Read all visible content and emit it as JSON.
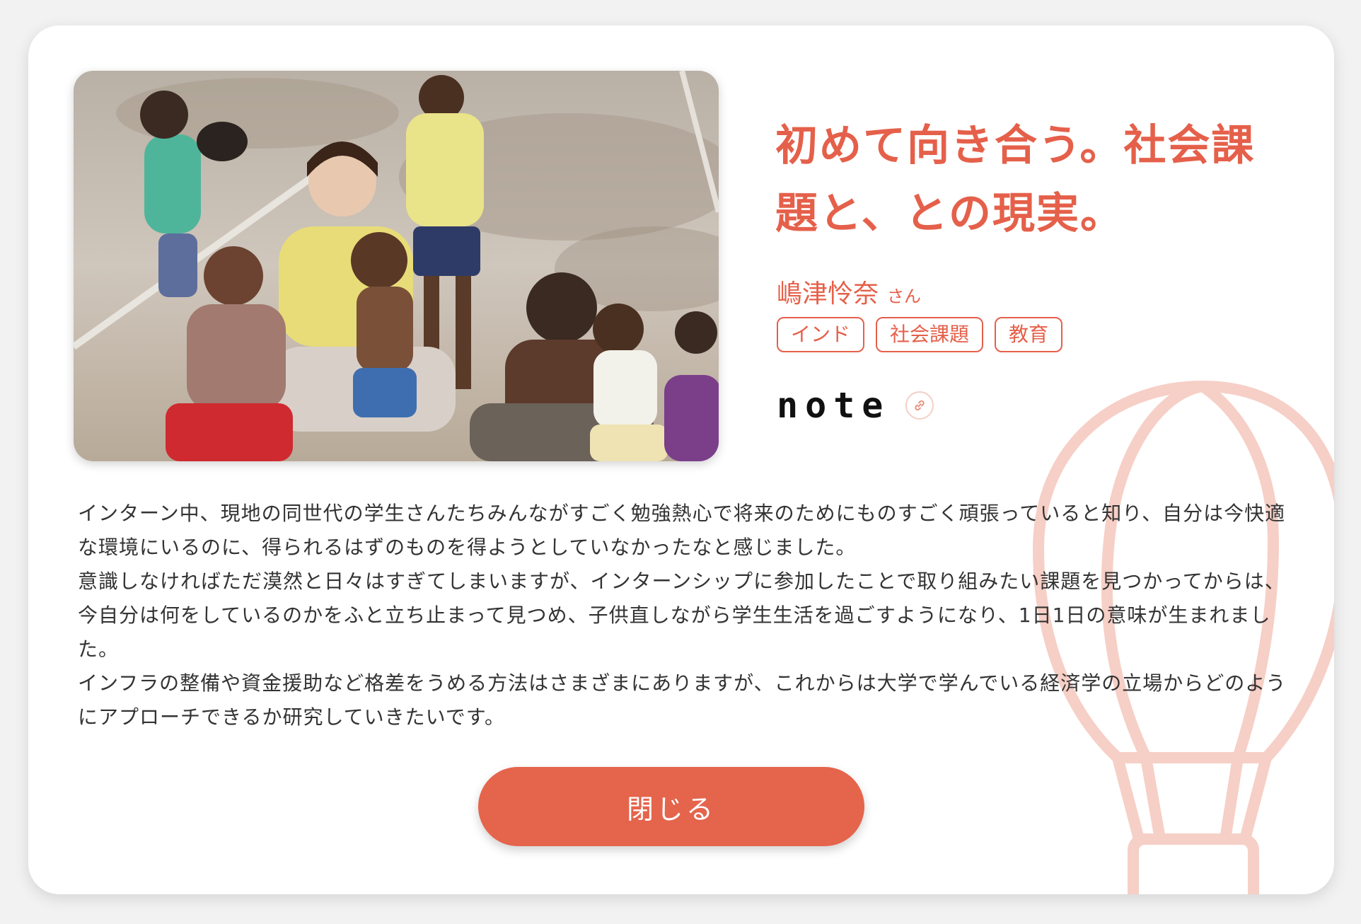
{
  "article": {
    "title": "初めて向き合う。社会課題と、との現実。",
    "author_name": "嶋津怜奈",
    "author_suffix": "さん",
    "tags": [
      "インド",
      "社会課題",
      "教育"
    ],
    "note_logo": "note",
    "body_paragraphs": [
      "インターン中、現地の同世代の学生さんたちみんながすごく勉強熱心で将来のためにものすごく頑張っていると知り、自分は今快適な環境にいるのに、得られるはずのものを得ようとしていなかったなと感じました。",
      "意識しなければただ漠然と日々はすぎてしまいますが、インターンシップに参加したことで取り組みたい課題を見つかってからは、今自分は何をしているのかをふと立ち止まって見つめ、子供直しながら学生生活を過ごすようになり、1日1日の意味が生まれました。",
      "インフラの整備や資金援助など格差をうめる方法はさまざまにありますが、これからは大学で学んでいる経済学の立場からどのようにアプローチできるか研究していきたいです。"
    ]
  },
  "close_button_label": "閉じる",
  "icons": {
    "link": "link-icon",
    "balloon": "hot-air-balloon-icon"
  },
  "colors": {
    "accent": "#e5604a",
    "button": "#e5644c",
    "balloon": "#f6cfc6",
    "body_text": "#333333"
  }
}
